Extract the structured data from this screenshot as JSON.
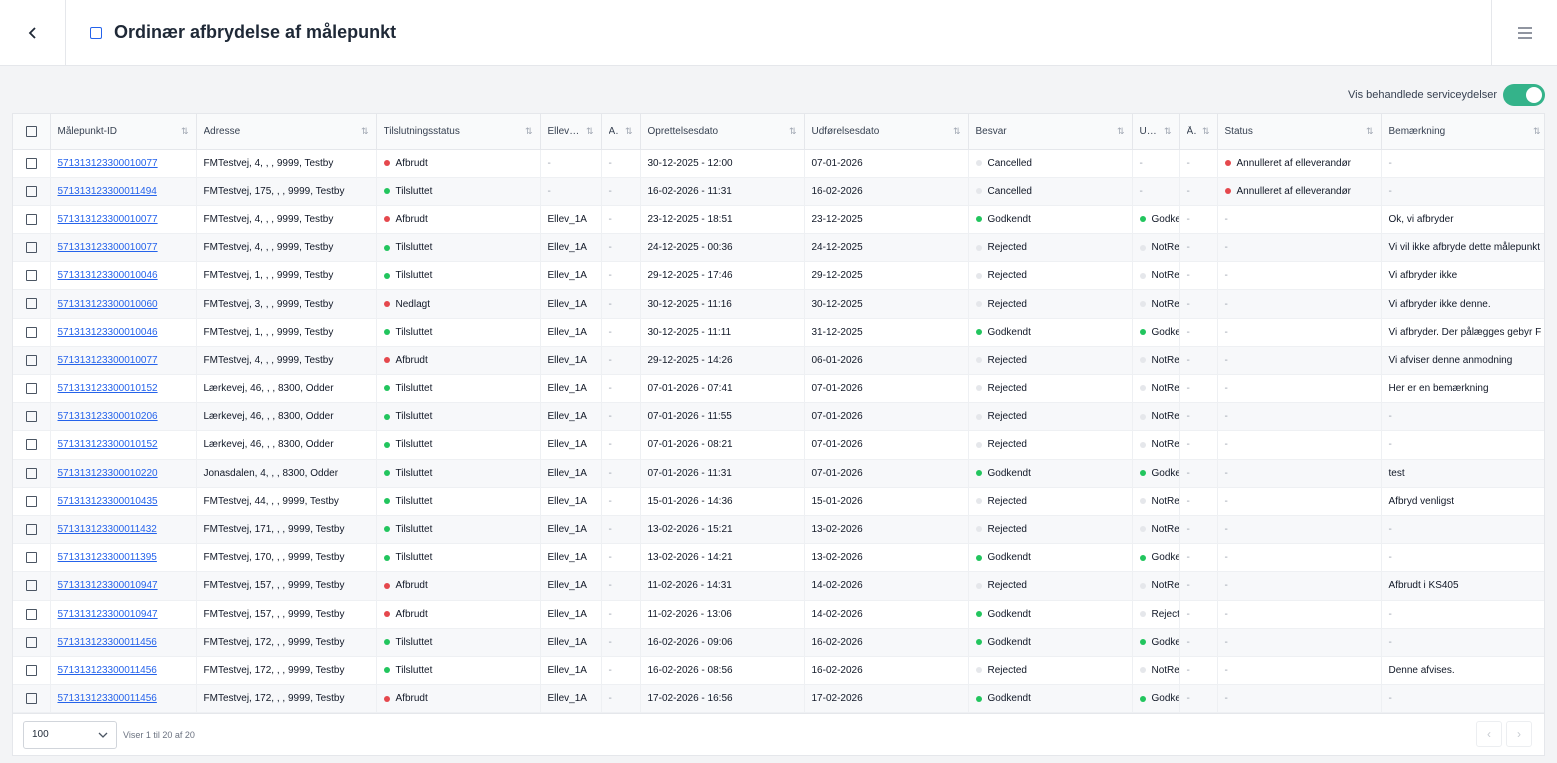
{
  "header": {
    "title": "Ordinær afbrydelse af målepunkt"
  },
  "toggle": {
    "label": "Vis behandlede serviceydelser",
    "state": "on",
    "color": "#34b38a"
  },
  "colors": {
    "red": "#e5484d",
    "green": "#22c55e",
    "grey": "#e5e7eb"
  },
  "columns": [
    "Målepunkt-ID",
    "Adresse",
    "Tilslutningsstatus",
    "Ellever...",
    "A...",
    "Oprettelsesdato",
    "Udførelsesdato",
    "Besvar",
    "Ud...",
    "Å...",
    "Status",
    "Bemærkning"
  ],
  "rows": [
    [
      "571313123300010077",
      "FMTestvej, 4, , , 9999, Testby",
      "Afbrudt",
      "-",
      "-",
      "30-12-2025 - 12:00",
      "07-01-2026",
      "Cancelled",
      "-",
      "-",
      "Annulleret af elleverandør",
      "-"
    ],
    [
      "571313123300011494",
      "FMTestvej, 175, , , 9999, Testby",
      "Tilsluttet",
      "-",
      "-",
      "16-02-2026 - 11:31",
      "16-02-2026",
      "Cancelled",
      "-",
      "-",
      "Annulleret af elleverandør",
      "-"
    ],
    [
      "571313123300010077",
      "FMTestvej, 4, , , 9999, Testby",
      "Afbrudt",
      "Ellev_1A",
      "-",
      "23-12-2025 - 18:51",
      "23-12-2025",
      "Godkendt",
      "Godke",
      "-",
      "-",
      "Ok, vi afbryder"
    ],
    [
      "571313123300010077",
      "FMTestvej, 4, , , 9999, Testby",
      "Tilsluttet",
      "Ellev_1A",
      "-",
      "24-12-2025 - 00:36",
      "24-12-2025",
      "Rejected",
      "NotRe",
      "-",
      "-",
      "Vi vil ikke afbryde dette målepunkt"
    ],
    [
      "571313123300010046",
      "FMTestvej, 1, , , 9999, Testby",
      "Tilsluttet",
      "Ellev_1A",
      "-",
      "29-12-2025 - 17:46",
      "29-12-2025",
      "Rejected",
      "NotRe",
      "-",
      "-",
      "Vi afbryder ikke"
    ],
    [
      "571313123300010060",
      "FMTestvej, 3, , , 9999, Testby",
      "Nedlagt",
      "Ellev_1A",
      "-",
      "30-12-2025 - 11:16",
      "30-12-2025",
      "Rejected",
      "NotRe",
      "-",
      "-",
      "Vi afbryder ikke denne."
    ],
    [
      "571313123300010046",
      "FMTestvej, 1, , , 9999, Testby",
      "Tilsluttet",
      "Ellev_1A",
      "-",
      "30-12-2025 - 11:11",
      "31-12-2025",
      "Godkendt",
      "Godke",
      "-",
      "-",
      "Vi afbryder. Der pålægges gebyr F"
    ],
    [
      "571313123300010077",
      "FMTestvej, 4, , , 9999, Testby",
      "Afbrudt",
      "Ellev_1A",
      "-",
      "29-12-2025 - 14:26",
      "06-01-2026",
      "Rejected",
      "NotRe",
      "-",
      "-",
      "Vi afviser denne anmodning"
    ],
    [
      "571313123300010152",
      "Lærkevej, 46, , , 8300, Odder",
      "Tilsluttet",
      "Ellev_1A",
      "-",
      "07-01-2026 - 07:41",
      "07-01-2026",
      "Rejected",
      "NotRe",
      "-",
      "-",
      "Her er en bemærkning"
    ],
    [
      "571313123300010206",
      "Lærkevej, 46, , , 8300, Odder",
      "Tilsluttet",
      "Ellev_1A",
      "-",
      "07-01-2026 - 11:55",
      "07-01-2026",
      "Rejected",
      "NotRe",
      "-",
      "-",
      "-"
    ],
    [
      "571313123300010152",
      "Lærkevej, 46, , , 8300, Odder",
      "Tilsluttet",
      "Ellev_1A",
      "-",
      "07-01-2026 - 08:21",
      "07-01-2026",
      "Rejected",
      "NotRe",
      "-",
      "-",
      "-"
    ],
    [
      "571313123300010220",
      "Jonasdalen, 4, , , 8300, Odder",
      "Tilsluttet",
      "Ellev_1A",
      "-",
      "07-01-2026 - 11:31",
      "07-01-2026",
      "Godkendt",
      "Godke",
      "-",
      "-",
      "test"
    ],
    [
      "571313123300010435",
      "FMTestvej, 44, , , 9999, Testby",
      "Tilsluttet",
      "Ellev_1A",
      "-",
      "15-01-2026 - 14:36",
      "15-01-2026",
      "Rejected",
      "NotRe",
      "-",
      "-",
      "Afbryd venligst"
    ],
    [
      "571313123300011432",
      "FMTestvej, 171, , , 9999, Testby",
      "Tilsluttet",
      "Ellev_1A",
      "-",
      "13-02-2026 - 15:21",
      "13-02-2026",
      "Rejected",
      "NotRe",
      "-",
      "-",
      "-"
    ],
    [
      "571313123300011395",
      "FMTestvej, 170, , , 9999, Testby",
      "Tilsluttet",
      "Ellev_1A",
      "-",
      "13-02-2026 - 14:21",
      "13-02-2026",
      "Godkendt",
      "Godke",
      "-",
      "-",
      "-"
    ],
    [
      "571313123300010947",
      "FMTestvej, 157, , , 9999, Testby",
      "Afbrudt",
      "Ellev_1A",
      "-",
      "11-02-2026 - 14:31",
      "14-02-2026",
      "Rejected",
      "NotRe",
      "-",
      "-",
      "Afbrudt i KS405"
    ],
    [
      "571313123300010947",
      "FMTestvej, 157, , , 9999, Testby",
      "Afbrudt",
      "Ellev_1A",
      "-",
      "11-02-2026 - 13:06",
      "14-02-2026",
      "Godkendt",
      "Reject",
      "-",
      "-",
      "-"
    ],
    [
      "571313123300011456",
      "FMTestvej, 172, , , 9999, Testby",
      "Tilsluttet",
      "Ellev_1A",
      "-",
      "16-02-2026 - 09:06",
      "16-02-2026",
      "Godkendt",
      "Godke",
      "-",
      "-",
      "-"
    ],
    [
      "571313123300011456",
      "FMTestvej, 172, , , 9999, Testby",
      "Tilsluttet",
      "Ellev_1A",
      "-",
      "16-02-2026 - 08:56",
      "16-02-2026",
      "Rejected",
      "NotRe",
      "-",
      "-",
      "Denne afvises."
    ],
    [
      "571313123300011456",
      "FMTestvej, 172, , , 9999, Testby",
      "Afbrudt",
      "Ellev_1A",
      "-",
      "17-02-2026 - 16:56",
      "17-02-2026",
      "Godkendt",
      "Godke",
      "-",
      "-",
      "-"
    ]
  ],
  "row_status_colors": {
    "Afbrudt": "red",
    "Nedlagt": "red",
    "Tilsluttet": "green",
    "Godkendt": "green",
    "Godke": "green",
    "Rejected": "grey",
    "Cancelled": "grey",
    "NotRe": "grey",
    "Reject": "grey",
    "Annulleret af elleverandør": "red"
  },
  "footer": {
    "page_size": "100",
    "summary": "Viser 1 til 20 af 20"
  },
  "icons": {
    "back": "chevron-left-icon",
    "menu": "hamburger-menu-icon",
    "sort": "sort-icon",
    "dropdown": "chevron-down-icon",
    "prev": "chevron-left-icon",
    "next": "chevron-right-icon"
  }
}
